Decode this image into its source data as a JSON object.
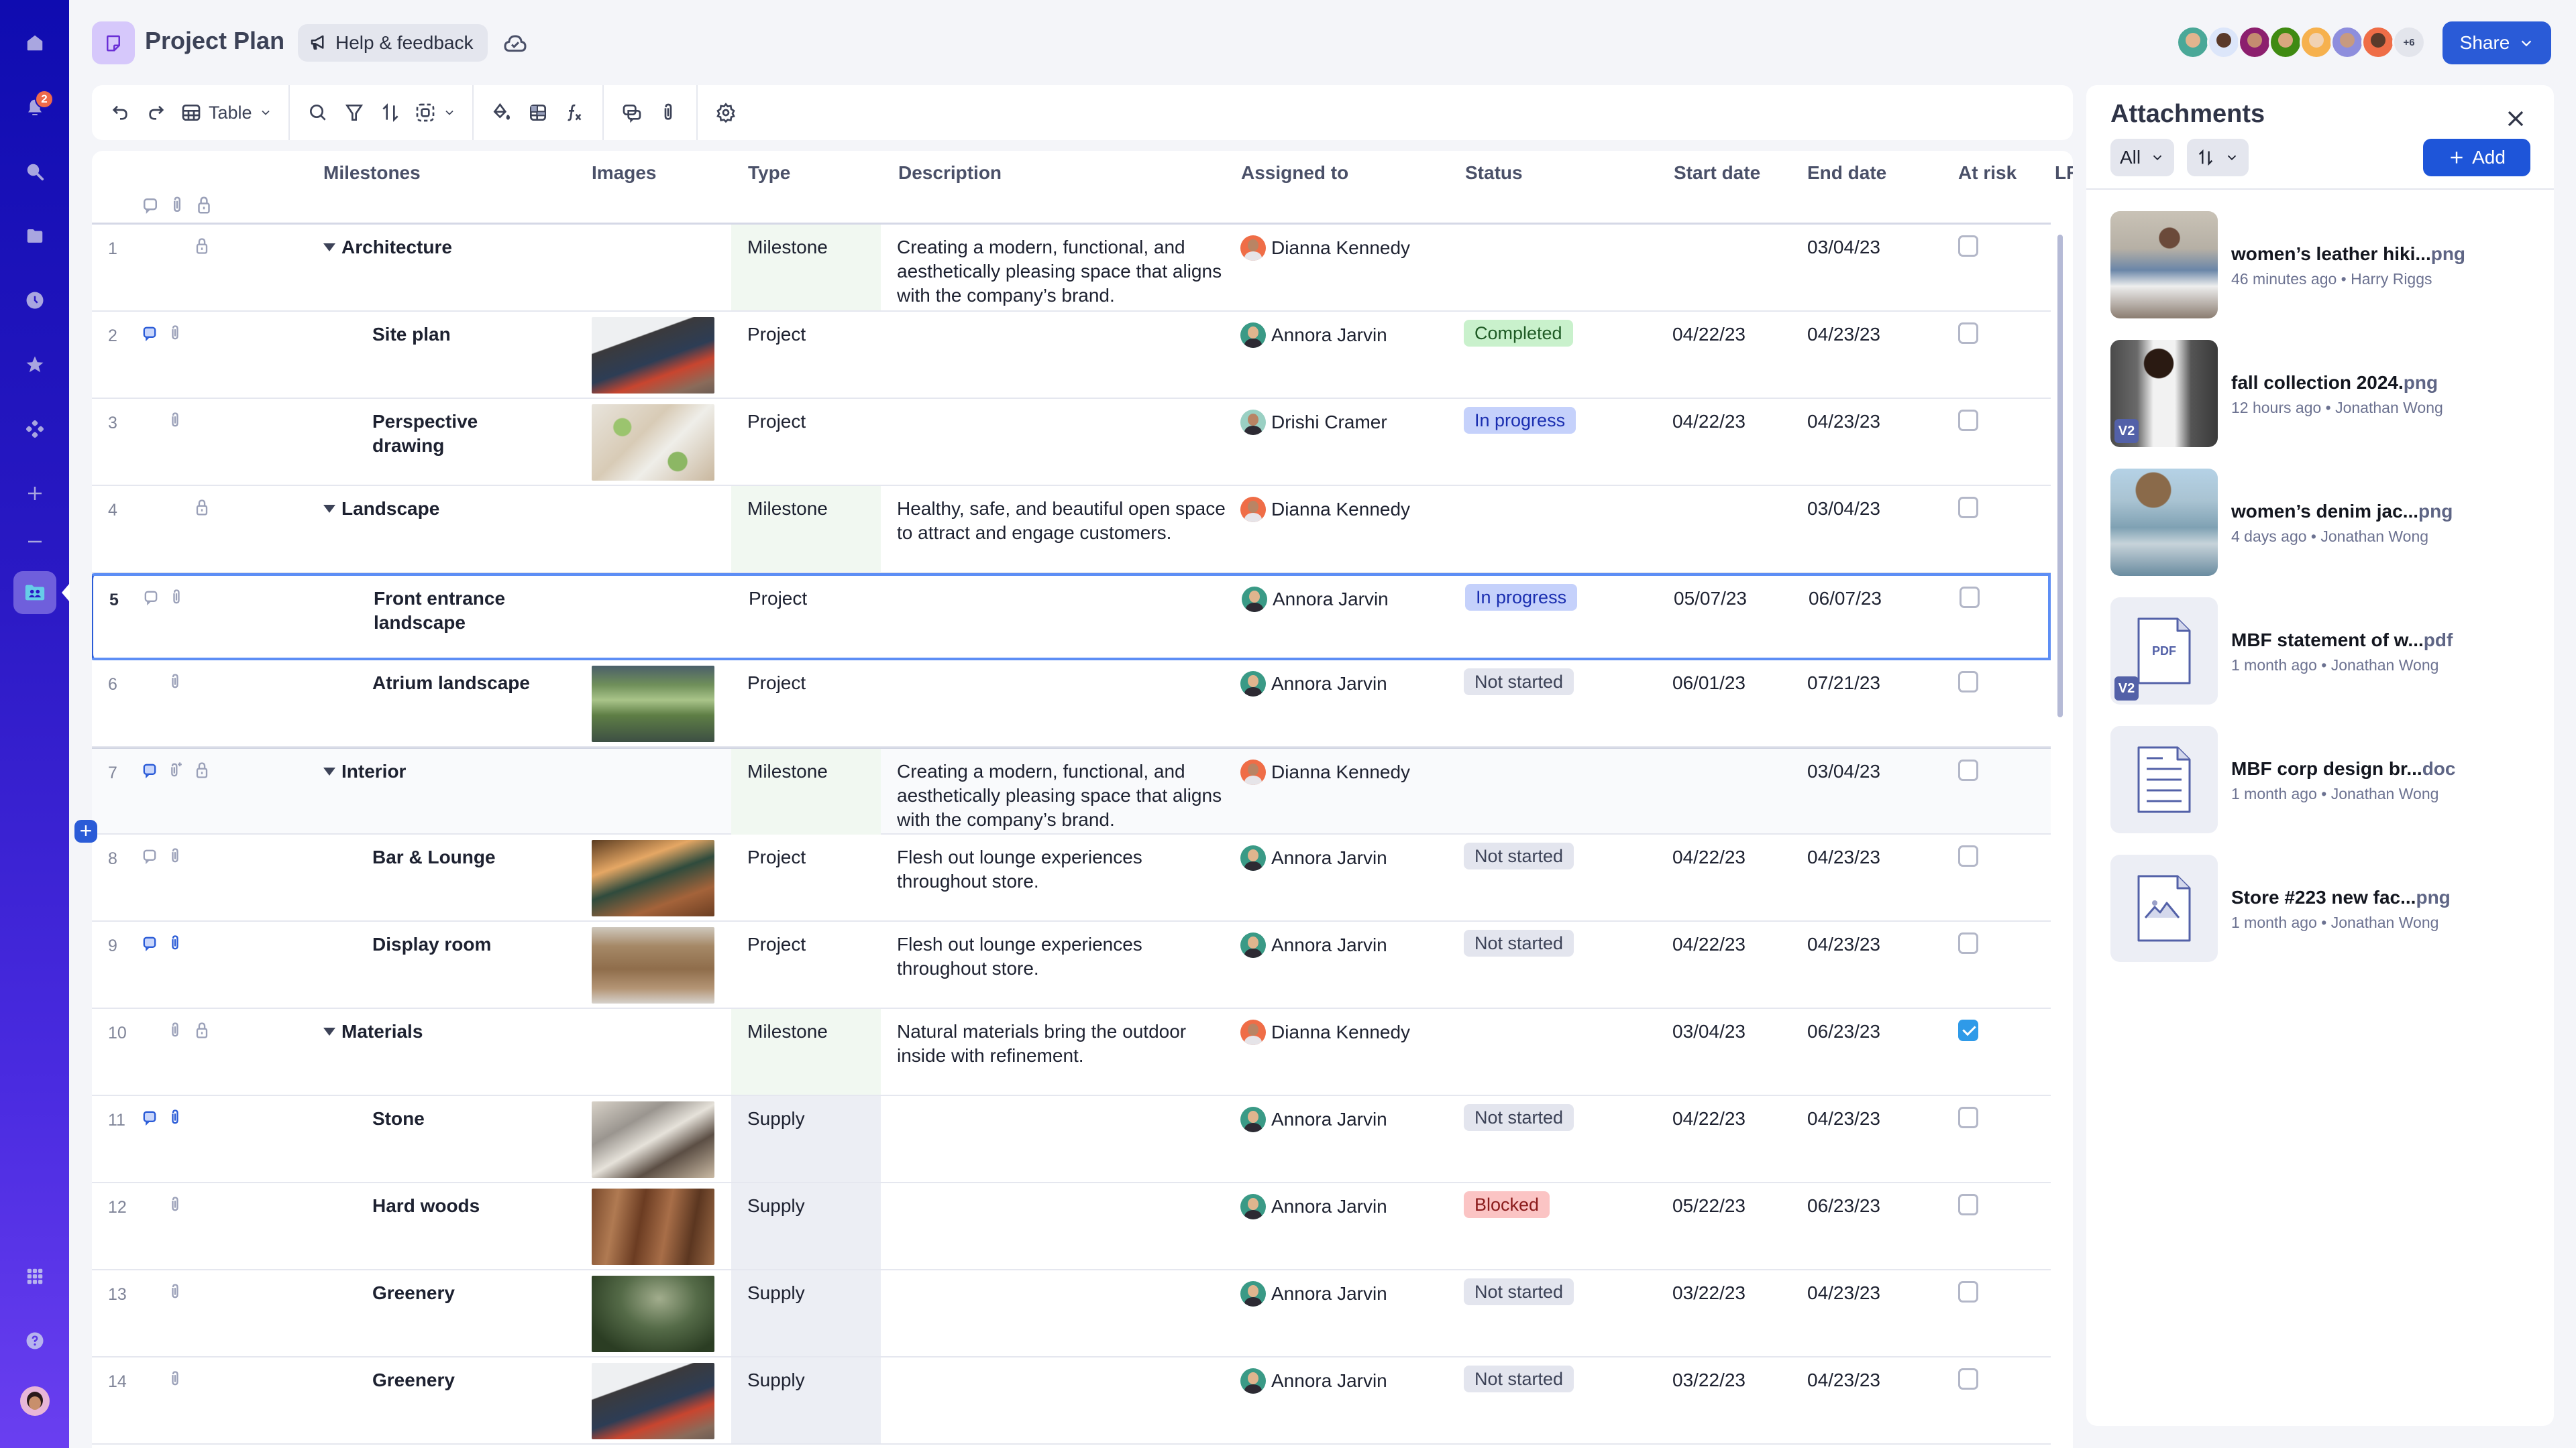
{
  "app": {
    "title": "Project Plan",
    "help_label": "Help & feedback",
    "share_label": "Share",
    "collaborators_more": "+6",
    "notification_count": "2"
  },
  "sidebar": {
    "items": [
      {
        "name": "home",
        "icon": "home-icon"
      },
      {
        "name": "notifications",
        "icon": "bell-icon"
      },
      {
        "name": "search",
        "icon": "search-icon"
      },
      {
        "name": "browse",
        "icon": "folder-icon"
      },
      {
        "name": "recents",
        "icon": "clock-icon"
      },
      {
        "name": "favorites",
        "icon": "star-icon"
      },
      {
        "name": "workapps",
        "icon": "apps-diamond-icon"
      },
      {
        "name": "create",
        "icon": "plus-icon"
      },
      {
        "name": "collapse",
        "icon": "minus-icon"
      },
      {
        "name": "workspace",
        "icon": "shared-folder-icon"
      },
      {
        "name": "launcher",
        "icon": "grid-icon"
      },
      {
        "name": "help",
        "icon": "question-icon"
      },
      {
        "name": "account",
        "icon": "user-avatar"
      }
    ]
  },
  "toolbar": {
    "view_label": "Table"
  },
  "table": {
    "columns": [
      "Milestones",
      "Images",
      "Type",
      "Description",
      "Assigned to",
      "Status",
      "Start date",
      "End date",
      "At risk",
      "LR"
    ],
    "rows": [
      {
        "num": "1",
        "name": "Architecture",
        "group": true,
        "icons": [
          "lock"
        ],
        "image": "",
        "type": "Milestone",
        "description": "Creating a modern, functional, and aesthetically pleasing space that aligns with the company’s brand.",
        "assignee": "Dianna Kennedy",
        "avatar": "dianna",
        "status": "",
        "start": "",
        "end": "03/04/23",
        "at_risk": false
      },
      {
        "num": "2",
        "name": "Site plan",
        "group": false,
        "icons": [
          "comment-active",
          "attach"
        ],
        "image": "architecture-sketch",
        "type": "Project",
        "description": "",
        "assignee": "Annora Jarvin",
        "avatar": "annora",
        "status": "Completed",
        "start": "04/22/23",
        "end": "04/23/23",
        "at_risk": false
      },
      {
        "num": "3",
        "name": "Perspective drawing",
        "group": false,
        "icons": [
          "attach"
        ],
        "image": "site-plan",
        "type": "Project",
        "description": "",
        "assignee": "Drishi Cramer",
        "avatar": "drishi",
        "status": "In progress",
        "start": "04/22/23",
        "end": "04/23/23",
        "at_risk": false
      },
      {
        "num": "4",
        "name": "Landscape",
        "group": true,
        "icons": [
          "lock"
        ],
        "image": "",
        "type": "Milestone",
        "description": "Healthy, safe, and beautiful open space to attract and engage customers.",
        "assignee": "Dianna Kennedy",
        "avatar": "dianna",
        "status": "",
        "start": "",
        "end": "03/04/23",
        "at_risk": false
      },
      {
        "num": "5",
        "name": "Front entrance landscape",
        "group": false,
        "icons": [
          "comment",
          "attach"
        ],
        "image": "",
        "type": "Project",
        "description": "",
        "assignee": "Annora Jarvin",
        "avatar": "annora",
        "status": "In progress",
        "start": "05/07/23",
        "end": "06/07/23",
        "at_risk": false,
        "selected": true
      },
      {
        "num": "6",
        "name": "Atrium landscape",
        "group": false,
        "icons": [
          "attach"
        ],
        "image": "rooftop-garden",
        "type": "Project",
        "description": "",
        "assignee": "Annora Jarvin",
        "avatar": "annora",
        "status": "Not started",
        "start": "06/01/23",
        "end": "07/21/23",
        "at_risk": false
      },
      {
        "num": "7",
        "name": "Interior",
        "group": true,
        "icons": [
          "comment-active",
          "attach-add",
          "lock"
        ],
        "image": "",
        "type": "Milestone",
        "description": "Creating a modern, functional, and aesthetically pleasing space that aligns with the company’s brand.",
        "assignee": "Dianna Kennedy",
        "avatar": "dianna",
        "status": "",
        "start": "",
        "end": "03/04/23",
        "at_risk": false,
        "hover": true
      },
      {
        "num": "8",
        "name": "Bar & Lounge",
        "group": false,
        "icons": [
          "comment",
          "attach"
        ],
        "image": "bar-stools",
        "type": "Project",
        "description": "Flesh out lounge experiences throughout store.",
        "assignee": "Annora Jarvin",
        "avatar": "annora",
        "status": "Not started",
        "start": "04/22/23",
        "end": "04/23/23",
        "at_risk": false
      },
      {
        "num": "9",
        "name": "Display room",
        "group": false,
        "icons": [
          "comment-active",
          "attach-active"
        ],
        "image": "wood-shelves",
        "type": "Project",
        "description": "Flesh out lounge experiences throughout store.",
        "assignee": "Annora Jarvin",
        "avatar": "annora",
        "status": "Not started",
        "start": "04/22/23",
        "end": "04/23/23",
        "at_risk": false
      },
      {
        "num": "10",
        "name": "Materials",
        "group": true,
        "icons": [
          "attach",
          "lock"
        ],
        "image": "",
        "type": "Milestone",
        "description": "Natural materials bring the outdoor inside with refinement.",
        "assignee": "Dianna Kennedy",
        "avatar": "dianna",
        "status": "",
        "start": "03/04/23",
        "end": "06/23/23",
        "at_risk": true
      },
      {
        "num": "11",
        "name": "Stone",
        "group": false,
        "icons": [
          "comment-active",
          "attach-active"
        ],
        "image": "stone-samples",
        "type": "Supply",
        "description": "",
        "assignee": "Annora Jarvin",
        "avatar": "annora",
        "status": "Not started",
        "start": "04/22/23",
        "end": "04/23/23",
        "at_risk": false
      },
      {
        "num": "12",
        "name": "Hard woods",
        "group": false,
        "icons": [
          "attach"
        ],
        "image": "wood-planks",
        "type": "Supply",
        "description": "",
        "assignee": "Annora Jarvin",
        "avatar": "annora",
        "status": "Blocked",
        "start": "05/22/23",
        "end": "06/23/23",
        "at_risk": false
      },
      {
        "num": "13",
        "name": "Greenery",
        "group": false,
        "icons": [
          "attach"
        ],
        "image": "plants",
        "type": "Supply",
        "description": "",
        "assignee": "Annora Jarvin",
        "avatar": "annora",
        "status": "Not started",
        "start": "03/22/23",
        "end": "04/23/23",
        "at_risk": false
      },
      {
        "num": "14",
        "name": "Greenery",
        "group": false,
        "icons": [
          "attach"
        ],
        "image": "architecture-sketch",
        "type": "Supply",
        "description": "",
        "assignee": "Annora Jarvin",
        "avatar": "annora",
        "status": "Not started",
        "start": "03/22/23",
        "end": "04/23/23",
        "at_risk": false
      }
    ]
  },
  "status_colors": {
    "Completed": "#c9f1cc",
    "In progress": "#c5d1fb",
    "Not started": "#e3e5ee",
    "Blocked": "#fbc4c4"
  },
  "attachments": {
    "title": "Attachments",
    "filter_label": "All",
    "add_label": "Add",
    "items": [
      {
        "base": "women’s leather hiki...",
        "ext": "png",
        "meta": "46 minutes ago • Harry Riggs",
        "kind": "photo",
        "photo": "denim-jacket-woman",
        "version": ""
      },
      {
        "base": "fall collection 2024.",
        "ext": "png",
        "meta": "12 hours ago • Jonathan Wong",
        "kind": "photo",
        "photo": "white-tee-woman",
        "version": "V2"
      },
      {
        "base": "women’s denim jac...",
        "ext": "png",
        "meta": "4 days ago • Jonathan Wong",
        "kind": "photo",
        "photo": "denim-jacket-sky",
        "version": ""
      },
      {
        "base": "MBF statement of w...",
        "ext": "pdf",
        "meta": "1 month ago • Jonathan Wong",
        "kind": "pdf",
        "file_label": "PDF",
        "version": "V2"
      },
      {
        "base": "MBF corp design br...",
        "ext": "doc",
        "meta": "1 month ago • Jonathan Wong",
        "kind": "doc",
        "version": ""
      },
      {
        "base": "Store #223 new fac...",
        "ext": "png",
        "meta": "1 month ago • Jonathan Wong",
        "kind": "image-file",
        "version": ""
      }
    ]
  }
}
